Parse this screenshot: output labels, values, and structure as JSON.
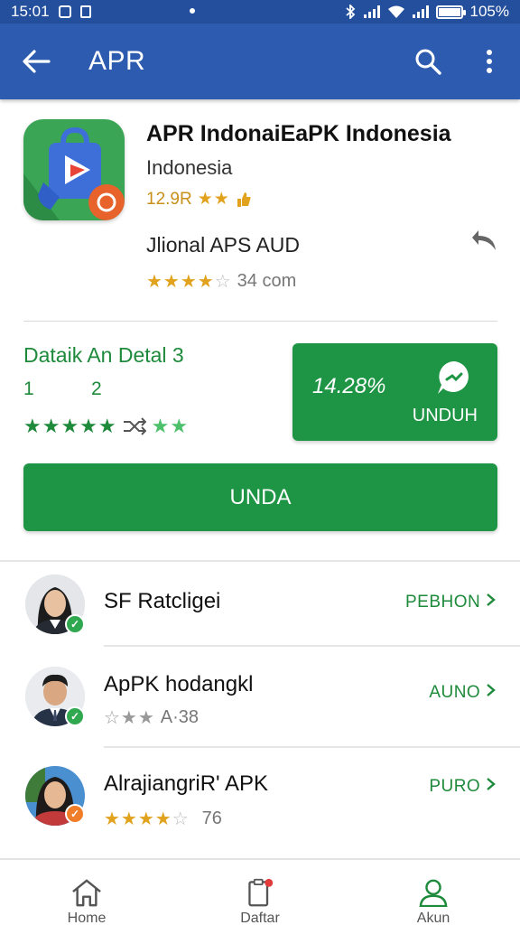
{
  "status_bar": {
    "time": "15:01",
    "battery": "105%"
  },
  "app_bar": {
    "title": "APR"
  },
  "app": {
    "name": "APR IndonaiEaPK Indonesia",
    "developer": "Indonesia",
    "rating_value": "12.9R",
    "subtitle": "Jlional APS AUD",
    "rating2_text": "34 com"
  },
  "details": {
    "title": "Dataik An Detal 3",
    "num1": "1",
    "num2": "2"
  },
  "download_button": {
    "value": "14.28%",
    "label": "UNDUH"
  },
  "primary_button": {
    "label": "UNDA"
  },
  "list": [
    {
      "name": "SF Ratcligei",
      "sub": "",
      "action": "PEBHON",
      "badge_color": "#2fa84f"
    },
    {
      "name": "ApPK hodangkl",
      "sub": "A·38",
      "action": "AUNO",
      "badge_color": "#2fa84f"
    },
    {
      "name": "AlrajiangriR' APK",
      "sub": "76",
      "action": "PURO",
      "badge_color": "#f07d2a"
    }
  ],
  "bottom_nav": {
    "items": [
      {
        "label": "Home",
        "icon": "home-icon"
      },
      {
        "label": "Daftar",
        "icon": "clipboard-icon"
      },
      {
        "label": "Akun",
        "icon": "person-icon"
      }
    ]
  },
  "colors": {
    "app_bar": "#2d5bb0",
    "status_bar": "#234f9c",
    "accent_green": "#1e9544",
    "star": "#e1a21d"
  }
}
